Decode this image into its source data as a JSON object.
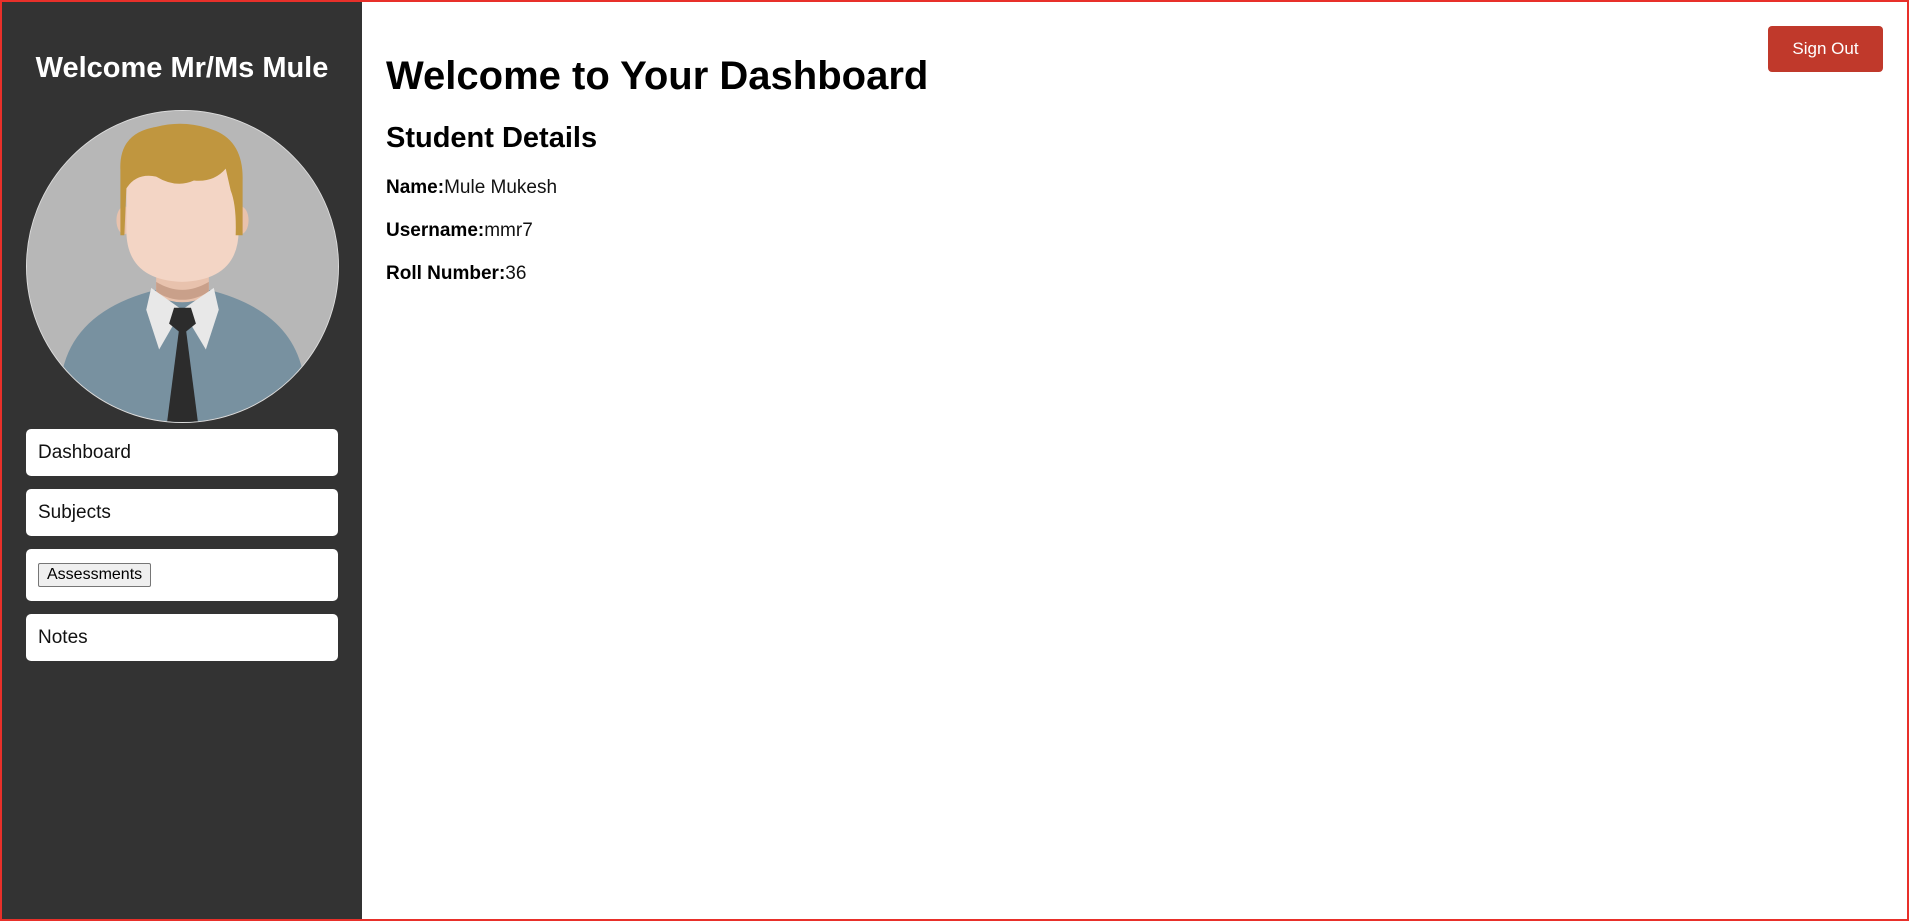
{
  "sidebar": {
    "welcome": "Welcome Mr/Ms Mule",
    "avatar_icon": "user-avatar-icon",
    "items": [
      {
        "label": "Dashboard"
      },
      {
        "label": "Subjects"
      },
      {
        "label": "Assessments"
      },
      {
        "label": "Notes"
      }
    ]
  },
  "header": {
    "signout_label": "Sign Out"
  },
  "main": {
    "title": "Welcome to Your Dashboard",
    "section_title": "Student Details",
    "details": [
      {
        "label": "Name:",
        "value": "Mule Mukesh"
      },
      {
        "label": "Username:",
        "value": "mmr7"
      },
      {
        "label": "Roll Number:",
        "value": "36"
      }
    ]
  },
  "colors": {
    "sidebar_bg": "#333333",
    "accent_red": "#c0392b",
    "frame_border": "#e8302a"
  }
}
